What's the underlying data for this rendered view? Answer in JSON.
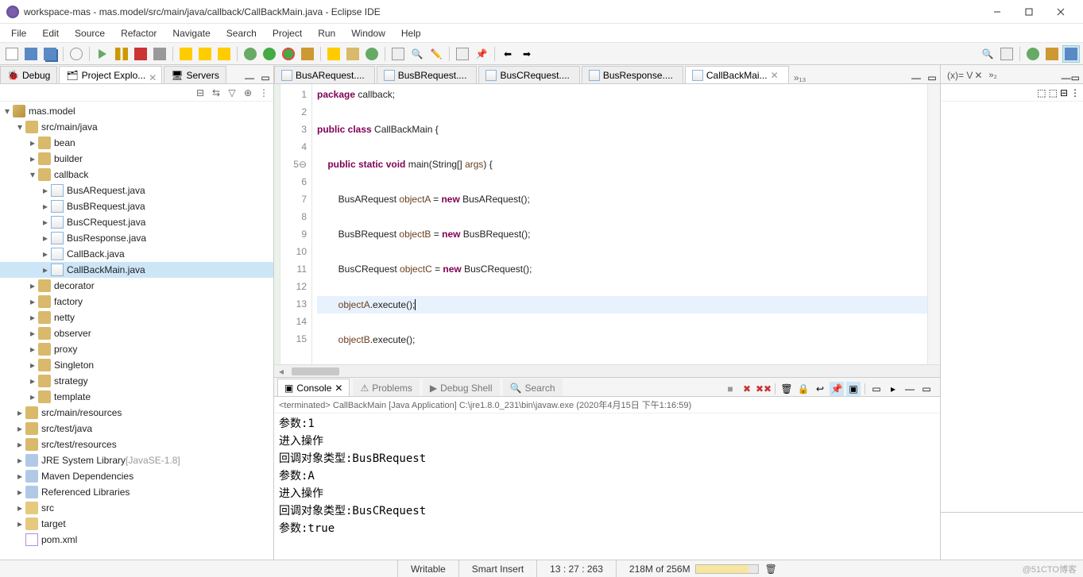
{
  "window": {
    "title": "workspace-mas - mas.model/src/main/java/callback/CallBackMain.java - Eclipse IDE"
  },
  "menu": [
    "File",
    "Edit",
    "Source",
    "Refactor",
    "Navigate",
    "Search",
    "Project",
    "Run",
    "Window",
    "Help"
  ],
  "left_views": {
    "debug_tab": "Debug",
    "explorer_tab": "Project Explo...",
    "servers_tab": "Servers"
  },
  "tree": {
    "project": "mas.model",
    "src_main_java": "src/main/java",
    "packages": [
      "bean",
      "builder"
    ],
    "callback": {
      "name": "callback",
      "files": [
        "BusARequest.java",
        "BusBRequest.java",
        "BusCRequest.java",
        "BusResponse.java",
        "CallBack.java",
        "CallBackMain.java"
      ]
    },
    "more_packages": [
      "decorator",
      "factory",
      "netty",
      "observer",
      "proxy",
      "Singleton",
      "strategy",
      "template"
    ],
    "src_main_resources": "src/main/resources",
    "src_test_java": "src/test/java",
    "src_test_resources": "src/test/resources",
    "jre": "JRE System Library",
    "jre_suffix": "[JavaSE-1.8]",
    "maven_deps": "Maven Dependencies",
    "referenced": "Referenced Libraries",
    "src_folder": "src",
    "target_folder": "target",
    "pom": "pom.xml"
  },
  "editor": {
    "tabs": [
      "BusARequest....",
      "BusBRequest....",
      "BusCRequest....",
      "BusResponse....",
      "CallBackMai..."
    ],
    "active_index": 4,
    "overflow_count": "»₁₃",
    "lines": [
      {
        "n": "1",
        "html": "<span class='kw'>package</span> callback;"
      },
      {
        "n": "2",
        "html": ""
      },
      {
        "n": "3",
        "html": "<span class='kw'>public class</span> CallBackMain {"
      },
      {
        "n": "4",
        "html": ""
      },
      {
        "n": "5⊖",
        "html": "    <span class='kw'>public static void</span> main(String[] <span class='id'>args</span>) {"
      },
      {
        "n": "6",
        "html": ""
      },
      {
        "n": "7",
        "html": "        BusARequest <span class='id'>objectA</span> = <span class='kw'>new</span> BusARequest();"
      },
      {
        "n": "8",
        "html": ""
      },
      {
        "n": "9",
        "html": "        BusBRequest <span class='id'>objectB</span> = <span class='kw'>new</span> BusBRequest();"
      },
      {
        "n": "10",
        "html": ""
      },
      {
        "n": "11",
        "html": "        BusCRequest <span class='id'>objectC</span> = <span class='kw'>new</span> BusCRequest();"
      },
      {
        "n": "12",
        "html": ""
      },
      {
        "n": "13",
        "html": "        <span class='id'>objectA</span>.execute();",
        "hl": true
      },
      {
        "n": "14",
        "html": ""
      },
      {
        "n": "15",
        "html": "        <span class='id'>objectB</span>.execute();"
      }
    ]
  },
  "right_panel": {
    "tab": "(x)= V",
    "overflow": "»₂"
  },
  "console": {
    "tabs": {
      "console": "Console",
      "problems": "Problems",
      "debug_shell": "Debug Shell",
      "search": "Search"
    },
    "header": "<terminated> CallBackMain [Java Application] C:\\jre1.8.0_231\\bin\\javaw.exe (2020年4月15日 下午1:16:59)",
    "output": "参数:1\n进入操作\n回调对象类型:BusBRequest\n参数:A\n进入操作\n回调对象类型:BusCRequest\n参数:true"
  },
  "status": {
    "writable": "Writable",
    "insert": "Smart Insert",
    "pos": "13 : 27 : 263",
    "mem": "218M of 256M"
  },
  "watermark": "@51CTO博客"
}
